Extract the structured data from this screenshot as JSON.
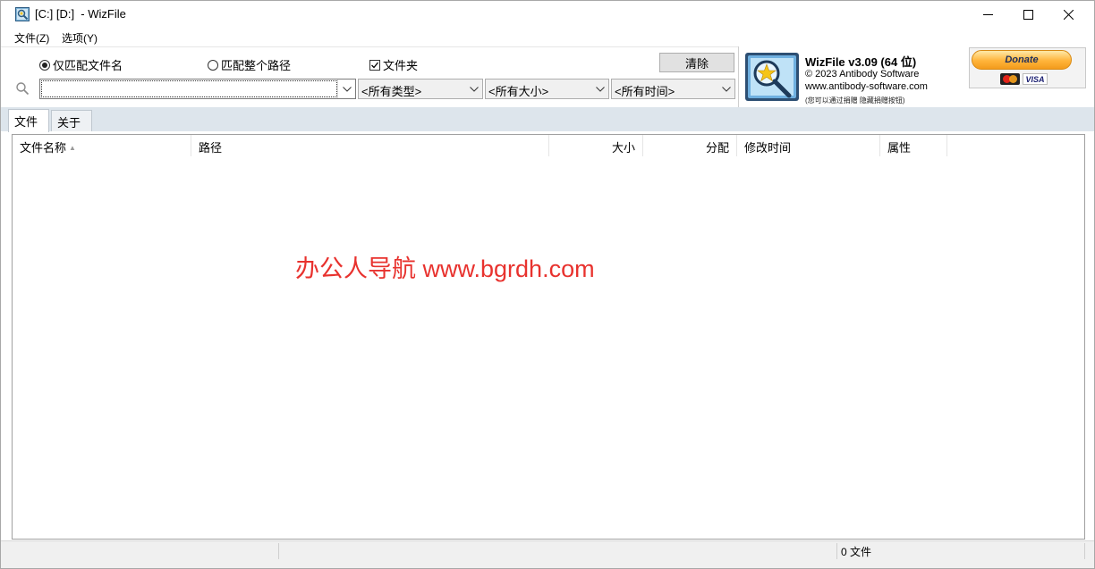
{
  "window": {
    "title": "[C:] [D:]  - WizFile",
    "icon": "wizfile-app-icon"
  },
  "menu": {
    "file": "文件(Z)",
    "options": "选项(Y)"
  },
  "search_options": {
    "match_filename": "仅匹配文件名",
    "match_full_path": "匹配整个路径",
    "folders": "文件夹",
    "match_filename_selected": true,
    "folders_checked": true
  },
  "toolbar": {
    "clear_label": "清除",
    "search_value": "",
    "type_filter": "<所有类型>",
    "size_filter": "<所有大小>",
    "time_filter": "<所有时间>"
  },
  "about": {
    "title": "WizFile v3.09 (64 位)",
    "copyright": "© 2023 Antibody Software",
    "url": "www.antibody-software.com",
    "note": "(您可以通过捐赠 隐藏捐赠按钮)",
    "donate_label": "Donate",
    "card_visa": "VISA"
  },
  "tabs": [
    {
      "label": "文件"
    },
    {
      "label": "关于"
    }
  ],
  "list": {
    "columns": [
      "文件名称",
      "路径",
      "大小",
      "分配",
      "修改时间",
      "属性"
    ],
    "rows": []
  },
  "overlay": {
    "watermark": "办公人导航 www.bgrdh.com"
  },
  "status": {
    "file_count": "0 文件"
  },
  "colors": {
    "watermark": "#e8322e",
    "tab_strip": "#dde5ec",
    "donate": "#ffb43a"
  }
}
